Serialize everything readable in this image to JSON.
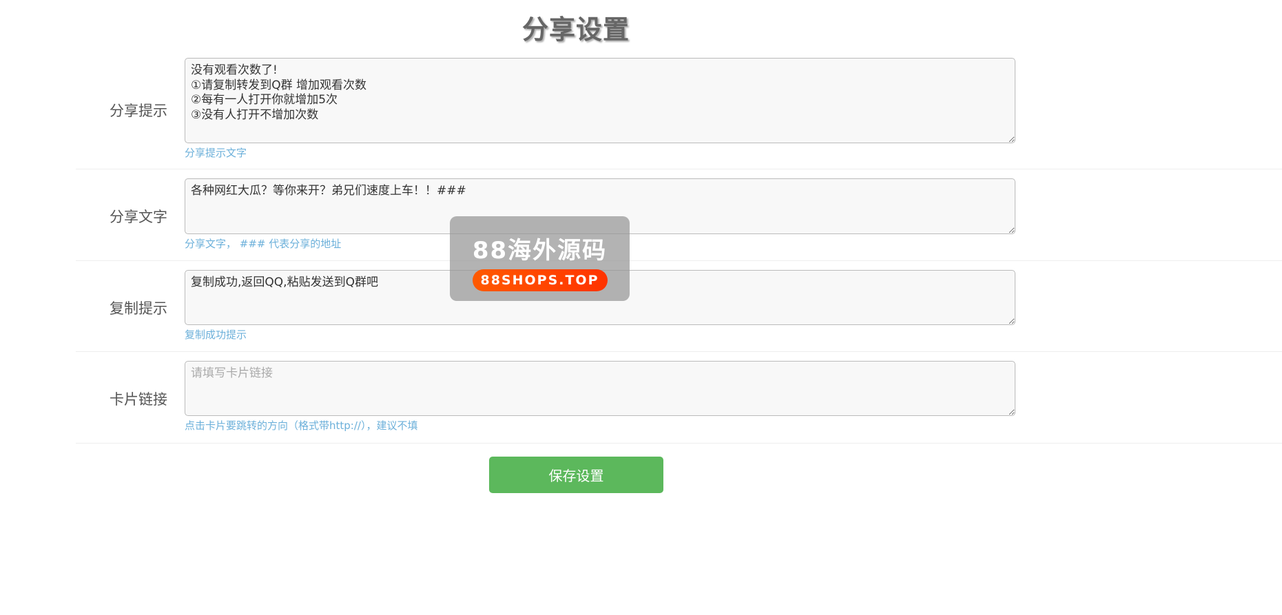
{
  "page": {
    "title": "分享设置"
  },
  "form": {
    "share_prompt": {
      "label": "分享提示",
      "value": "没有观看次数了!\n①请复制转发到Q群 增加观看次数\n②每有一人打开你就增加5次\n③没有人打开不增加次数",
      "help": "分享提示文字"
    },
    "share_text": {
      "label": "分享文字",
      "value": "各种网红大瓜？等你来开？弟兄们速度上车！！###",
      "help": "分享文字， ### 代表分享的地址"
    },
    "copy_prompt": {
      "label": "复制提示",
      "value": "复制成功,返回QQ,粘贴发送到Q群吧",
      "help": "复制成功提示"
    },
    "card_link": {
      "label": "卡片链接",
      "value": "",
      "placeholder": "请填写卡片链接",
      "help": "点击卡片要跳转的方向（格式带http://），建议不填"
    }
  },
  "actions": {
    "save_label": "保存设置"
  },
  "watermark": {
    "title": "88海外源码",
    "url": "88SHOPS.TOP"
  },
  "colors": {
    "accent_green": "#5cb85c",
    "help_blue": "#6cb0da",
    "watermark_orange": "#ff5a00"
  }
}
